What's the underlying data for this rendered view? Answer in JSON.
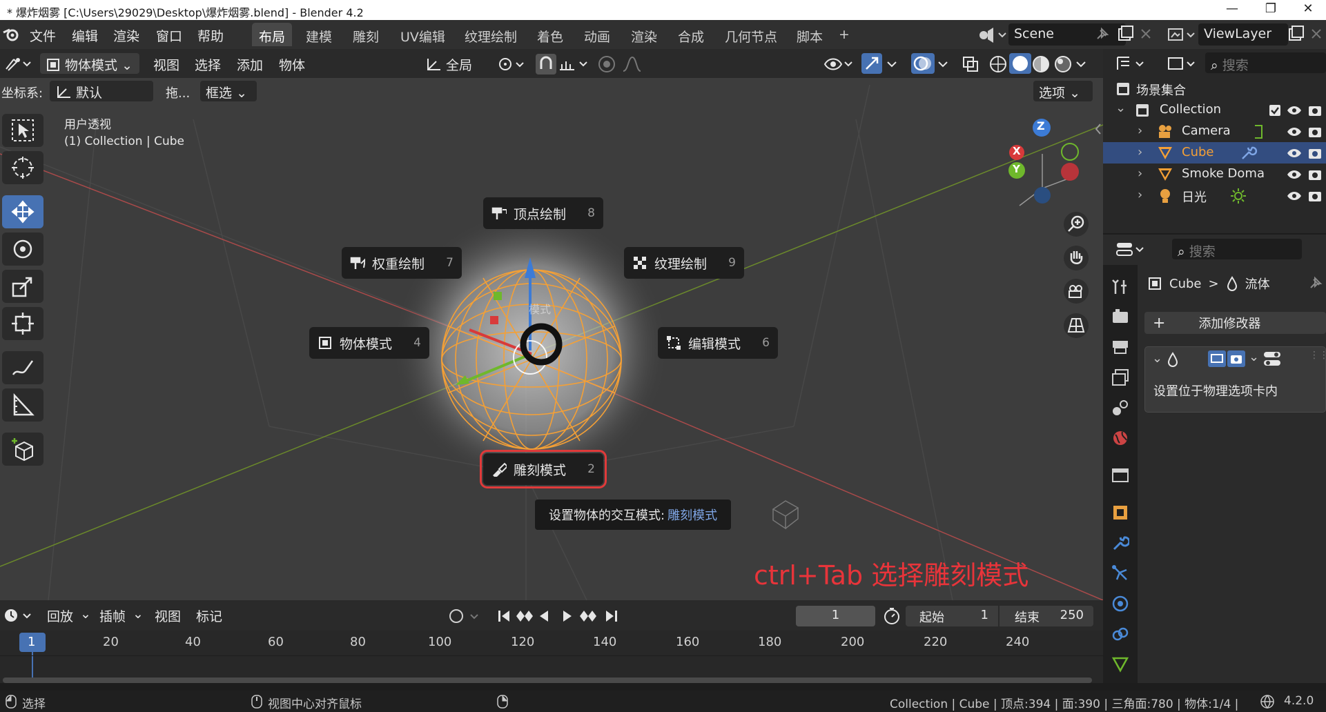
{
  "window": {
    "title": "* 爆炸烟雾 [C:\\Users\\29029\\Desktop\\爆炸烟雾.blend] - Blender 4.2",
    "minimize": "—",
    "maximize": "❐",
    "close": "✕"
  },
  "menu": {
    "file": "文件",
    "edit": "编辑",
    "render": "渲染",
    "window": "窗口",
    "help": "帮助"
  },
  "workspaces": [
    "布局",
    "建模",
    "雕刻",
    "UV编辑",
    "纹理绘制",
    "着色",
    "动画",
    "渲染",
    "合成",
    "几何节点",
    "脚本"
  ],
  "workspace_add": "+",
  "scene": {
    "name": "Scene",
    "view_layer": "ViewLayer"
  },
  "viewport_header": {
    "mode": "物体模式",
    "view": "视图",
    "select": "选择",
    "add": "添加",
    "object": "物体",
    "transform_orientation": "全局",
    "options": "选项",
    "coord_label": "坐标系:",
    "coord_value": "默认",
    "drag_label": "拖...",
    "drag_value": "框选"
  },
  "viewport": {
    "view_name": "用户透视",
    "collection_info": "(1) Collection | Cube",
    "hint": "ctrl+Tab 选择雕刻模式",
    "mode_ghost": "模式",
    "gizmo": {
      "z": "Z",
      "x": "X",
      "y": "Y"
    }
  },
  "pie_menu": {
    "vertex_paint": {
      "label": "顶点绘制",
      "key": "8"
    },
    "weight_paint": {
      "label": "权重绘制",
      "key": "7"
    },
    "texture_paint": {
      "label": "纹理绘制",
      "key": "9"
    },
    "object_mode": {
      "label": "物体模式",
      "key": "4"
    },
    "edit_mode": {
      "label": "编辑模式",
      "key": "6"
    },
    "sculpt_mode": {
      "label": "雕刻模式",
      "key": "2"
    },
    "tooltip_prefix": "设置物体的交互模式: ",
    "tooltip_value": "雕刻模式"
  },
  "outliner": {
    "search_placeholder": "搜索",
    "scene_collection": "场景集合",
    "items": [
      {
        "name": "Collection"
      },
      {
        "name": "Camera"
      },
      {
        "name": "Cube"
      },
      {
        "name": "Smoke Doma"
      },
      {
        "name": "日光"
      }
    ]
  },
  "properties": {
    "search_placeholder": "搜索",
    "breadcrumb_object": "Cube",
    "breadcrumb_sep": ">",
    "breadcrumb_modifier": "流体",
    "add_modifier": "添加修改器",
    "modifier_note": "设置位于物理选项卡内"
  },
  "timeline": {
    "playback": "回放",
    "keying": "插帧",
    "view": "视图",
    "marker": "标记",
    "current_frame": "1",
    "start_label": "起始",
    "start_value": "1",
    "end_label": "结束",
    "end_value": "250",
    "ticks": [
      "1",
      "20",
      "40",
      "60",
      "80",
      "100",
      "120",
      "140",
      "160",
      "180",
      "200",
      "220",
      "240"
    ]
  },
  "statusbar": {
    "select": "选择",
    "center_view": "视图中心对齐鼠标",
    "stats": "Collection | Cube | 顶点:394 | 面:390 | 三角面:780 | 物体:1/4 |",
    "version": "4.2.0"
  },
  "colors": {
    "accent": "#4772b3",
    "object_orange": "#f5a035",
    "highlight_red": "#e03a3a",
    "hint_red": "#e8343a"
  }
}
